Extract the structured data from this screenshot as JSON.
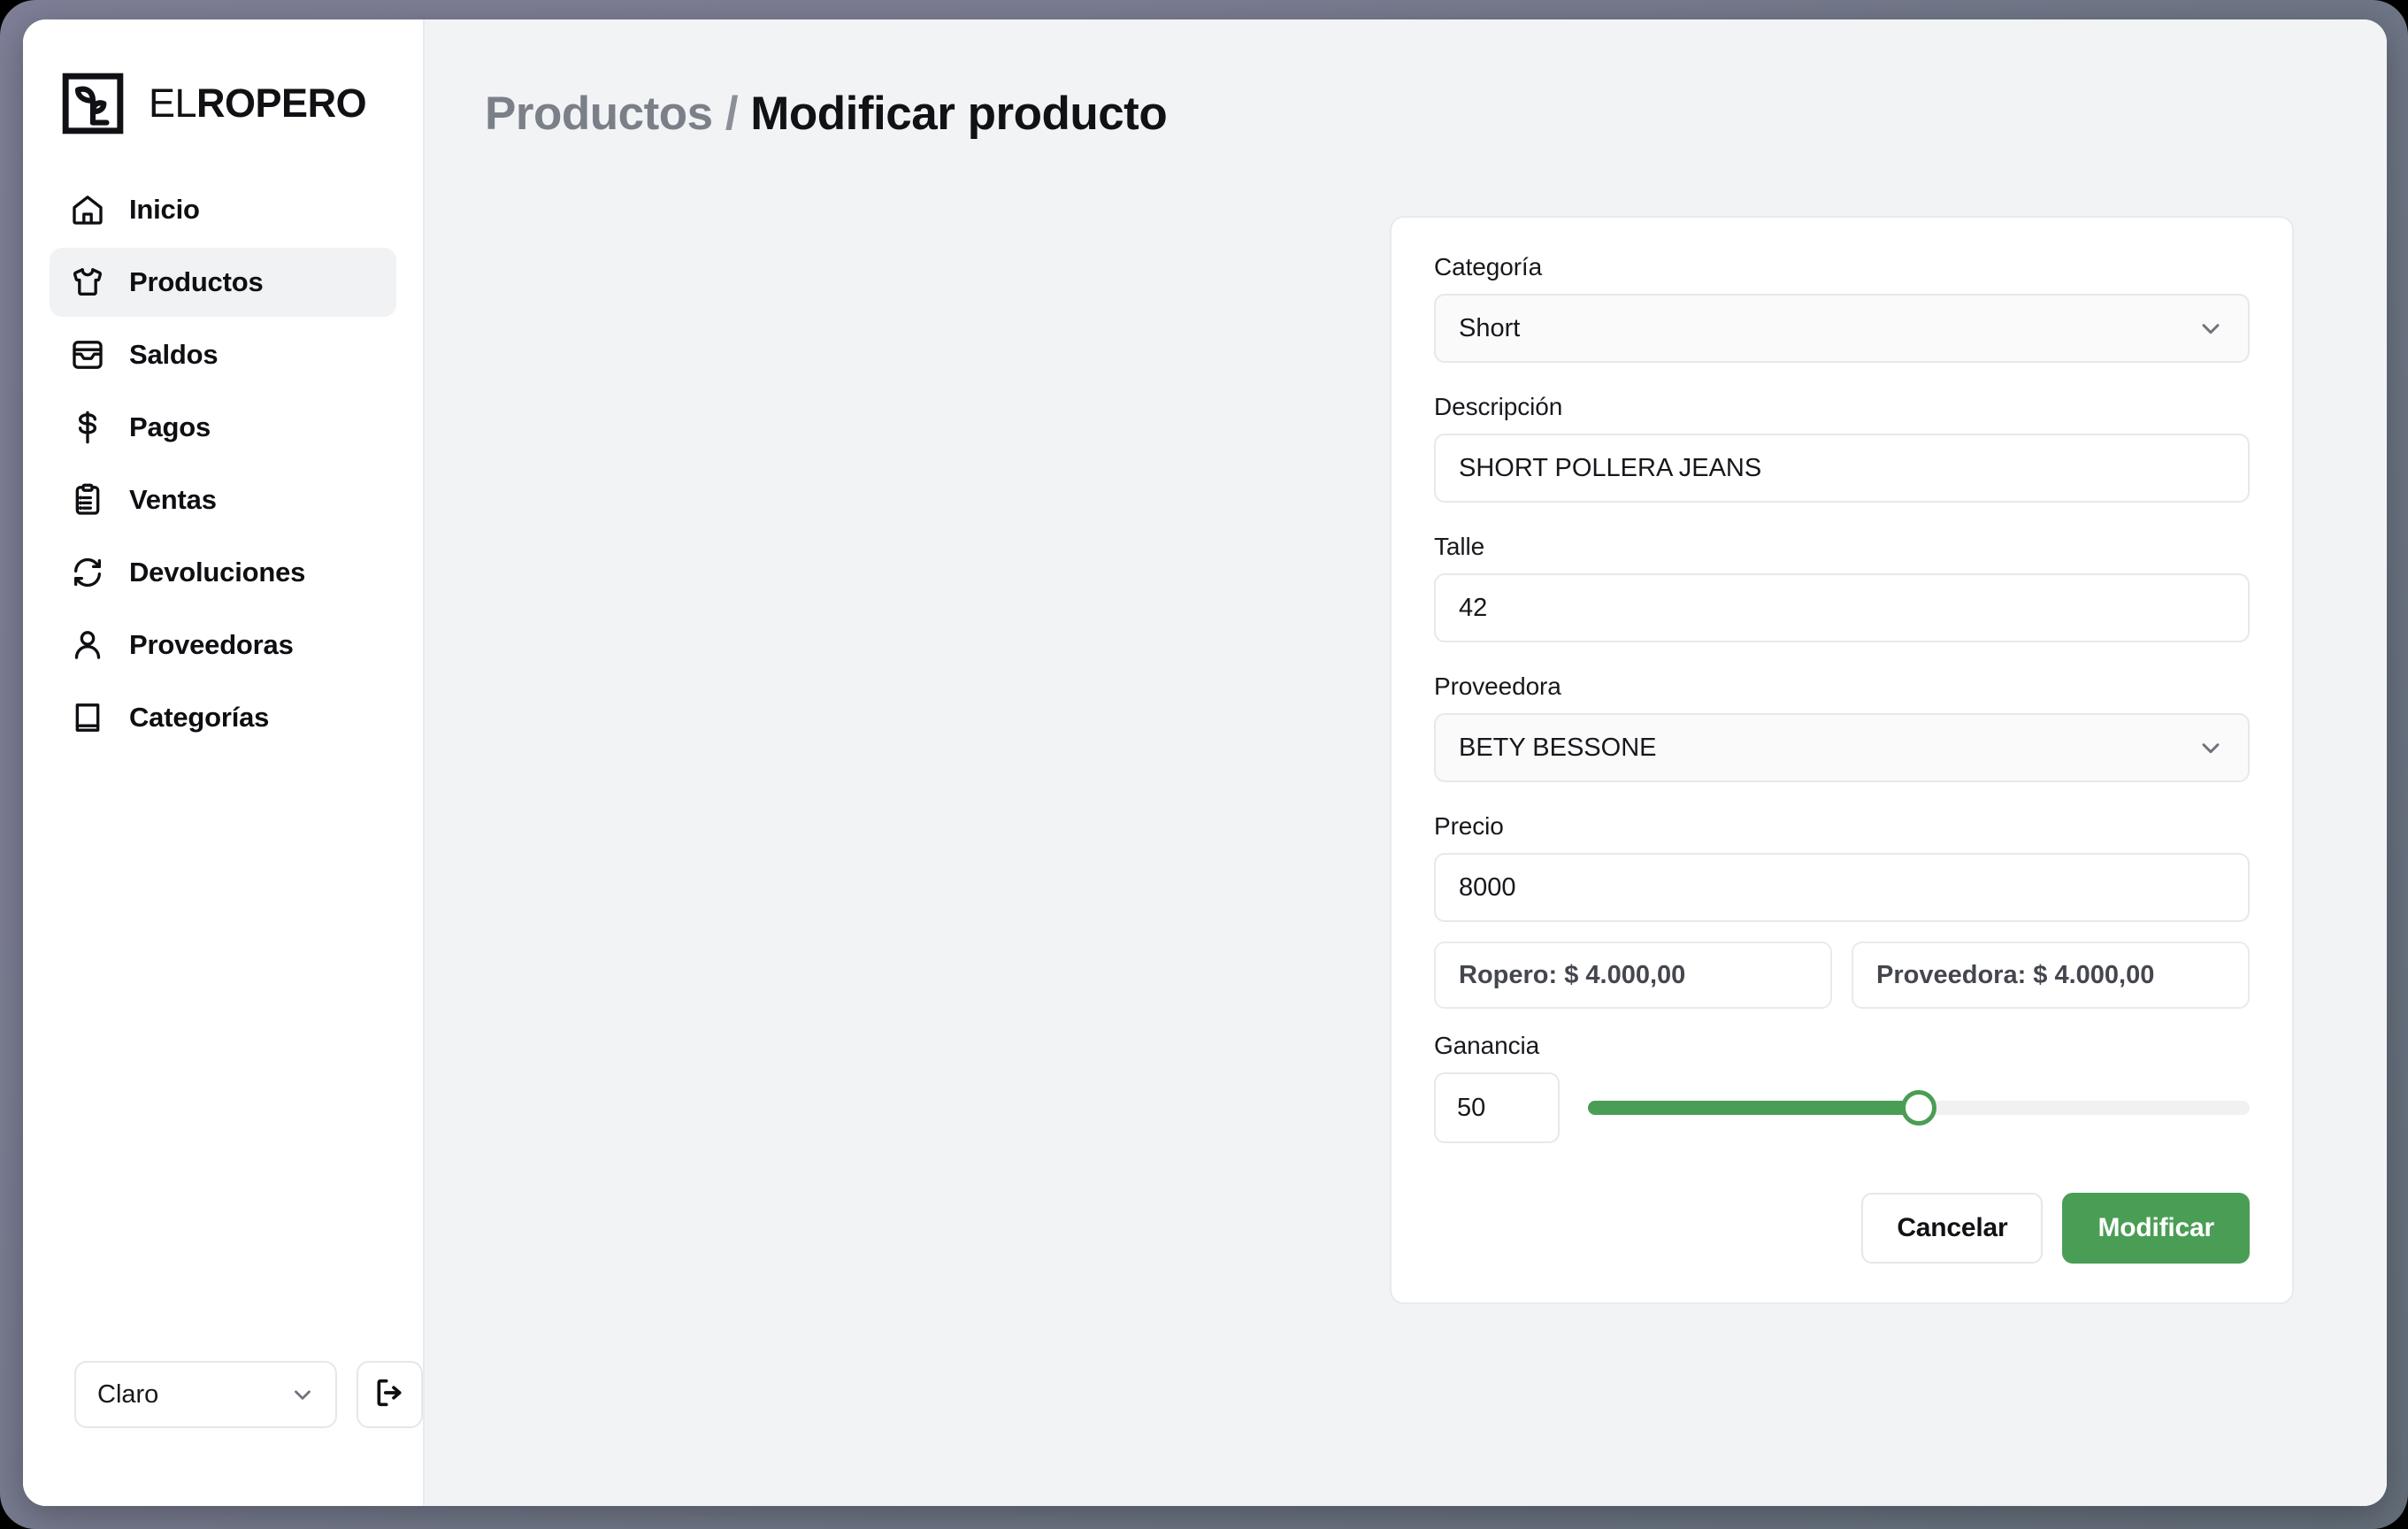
{
  "brand": {
    "text_light": "EL",
    "text_bold": "ROPERO",
    "logo_icon": "sprout-in-square-icon"
  },
  "sidebar": {
    "items": [
      {
        "label": "Inicio",
        "icon": "home-icon",
        "active": false
      },
      {
        "label": "Productos",
        "icon": "tshirt-icon",
        "active": true
      },
      {
        "label": "Saldos",
        "icon": "inbox-icon",
        "active": false
      },
      {
        "label": "Pagos",
        "icon": "dollar-sign-icon",
        "active": false
      },
      {
        "label": "Ventas",
        "icon": "clipboard-list-icon",
        "active": false
      },
      {
        "label": "Devoluciones",
        "icon": "refresh-cycle-icon",
        "active": false
      },
      {
        "label": "Proveedoras",
        "icon": "user-icon",
        "active": false
      },
      {
        "label": "Categorías",
        "icon": "book-icon",
        "active": false
      }
    ],
    "footer": {
      "theme_label": "Claro",
      "theme_chevron_icon": "chevron-down-icon",
      "logout_icon": "logout-icon"
    }
  },
  "header": {
    "breadcrumb_parent": "Productos",
    "breadcrumb_separator": "/",
    "breadcrumb_current": "Modificar producto"
  },
  "form": {
    "categoria": {
      "label": "Categoría",
      "value": "Short",
      "chevron_icon": "chevron-down-icon"
    },
    "descripcion": {
      "label": "Descripción",
      "value": "SHORT POLLERA JEANS"
    },
    "talle": {
      "label": "Talle",
      "value": "42"
    },
    "proveedora": {
      "label": "Proveedora",
      "value": "BETY BESSONE",
      "chevron_icon": "chevron-down-icon"
    },
    "precio": {
      "label": "Precio",
      "value": "8000"
    },
    "readouts": [
      {
        "text": "Ropero: $ 4.000,00"
      },
      {
        "text": "Proveedora: $ 4.000,00"
      }
    ],
    "ganancia": {
      "label": "Ganancia",
      "value": "50",
      "slider_percent": 50
    },
    "buttons": {
      "cancel": "Cancelar",
      "submit": "Modificar"
    }
  },
  "colors": {
    "accent_green": "#4a9d54",
    "page_bg": "#f2f3f5",
    "sidebar_bg": "#ffffff",
    "active_item_bg": "#f1f2f4",
    "border": "#e7e8ec",
    "text": "#16181c",
    "muted_text": "#7b7f88",
    "frame": "#7b7d93"
  }
}
